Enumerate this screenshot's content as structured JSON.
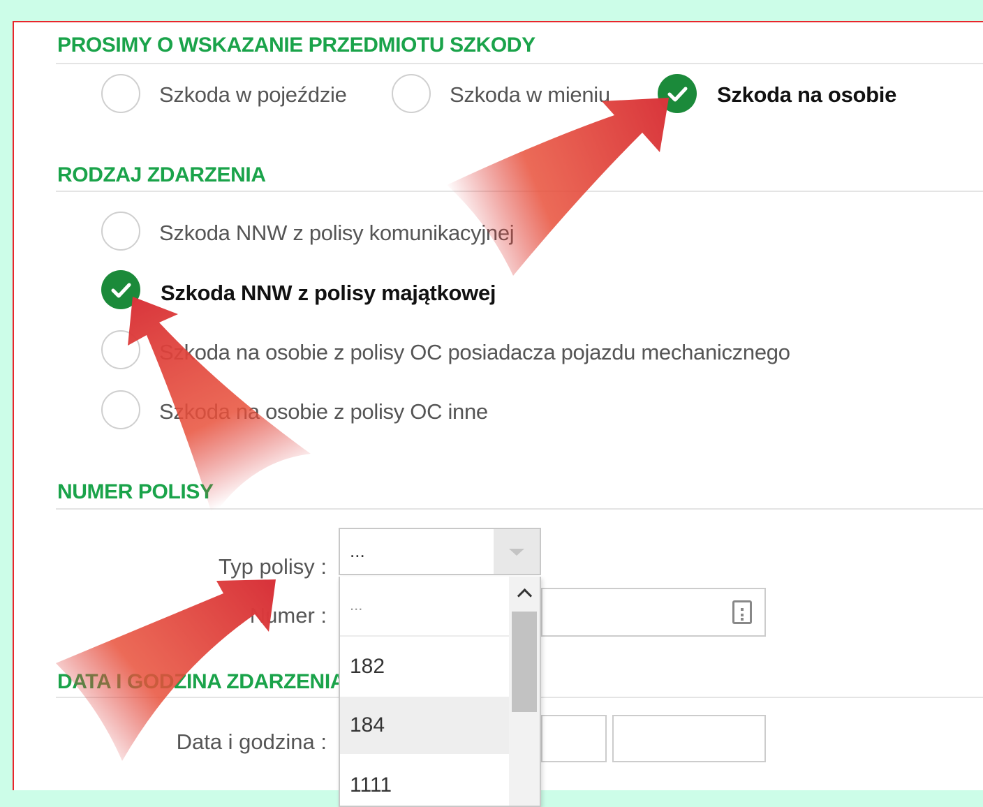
{
  "sections": {
    "subject": {
      "title": "PROSIMY O WSKAZANIE PRZEDMIOTU SZKODY",
      "options": [
        {
          "label": "Szkoda w pojeździe",
          "checked": false
        },
        {
          "label": "Szkoda w mieniu",
          "checked": false
        },
        {
          "label": "Szkoda na osobie",
          "checked": true
        }
      ]
    },
    "event_type": {
      "title": "RODZAJ ZDARZENIA",
      "options": [
        {
          "label": "Szkoda NNW z polisy komunikacyjnej",
          "checked": false
        },
        {
          "label": "Szkoda NNW z polisy majątkowej",
          "checked": true
        },
        {
          "label": "Szkoda na osobie z polisy OC posiadacza pojazdu mechanicznego",
          "checked": false
        },
        {
          "label": "Szkoda na osobie z polisy OC inne",
          "checked": false
        }
      ]
    },
    "policy": {
      "title": "NUMER POLISY",
      "type_label": "Typ polisy :",
      "type_value": "...",
      "number_label": "Numer :",
      "dropdown_options": [
        "...",
        "182",
        "184",
        "1111"
      ]
    },
    "datetime": {
      "title": "DATA I GODZINA ZDARZENIA",
      "label": "Data i godzina :"
    }
  },
  "colors": {
    "accent_green": "#1aa34a",
    "checked_green": "#1b8a3a",
    "panel_border": "#e8262b",
    "page_background": "#ccfde8",
    "annotation_arrow": "#d8343b"
  }
}
